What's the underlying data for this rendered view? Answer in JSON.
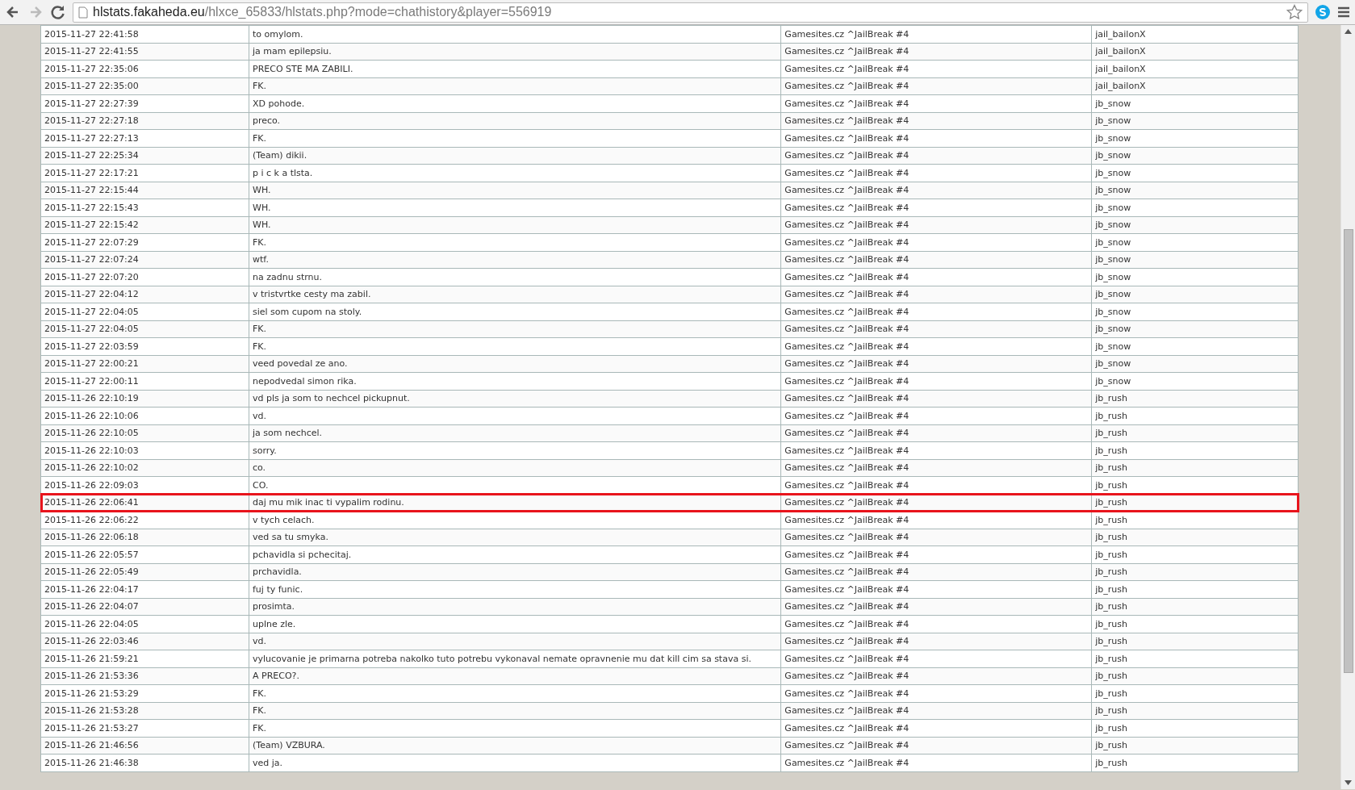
{
  "browser": {
    "url": {
      "host": "hlstats.fakaheda.eu",
      "path": "/hlxce_65833/hlstats.php?mode=chathistory&player=556919"
    }
  },
  "table": {
    "rows": [
      {
        "time": "2015-11-27 22:41:58",
        "message": "to omylom.",
        "server": "Gamesites.cz ^JailBreak #4",
        "map": "jail_bailonX",
        "selected": false
      },
      {
        "time": "2015-11-27 22:41:55",
        "message": "ja mam epilepsiu.",
        "server": "Gamesites.cz ^JailBreak #4",
        "map": "jail_bailonX",
        "selected": false
      },
      {
        "time": "2015-11-27 22:35:06",
        "message": "PRECO STE MA ZABILI.",
        "server": "Gamesites.cz ^JailBreak #4",
        "map": "jail_bailonX",
        "selected": false
      },
      {
        "time": "2015-11-27 22:35:00",
        "message": "FK.",
        "server": "Gamesites.cz ^JailBreak #4",
        "map": "jail_bailonX",
        "selected": false
      },
      {
        "time": "2015-11-27 22:27:39",
        "message": "XD pohode.",
        "server": "Gamesites.cz ^JailBreak #4",
        "map": "jb_snow",
        "selected": false
      },
      {
        "time": "2015-11-27 22:27:18",
        "message": "preco.",
        "server": "Gamesites.cz ^JailBreak #4",
        "map": "jb_snow",
        "selected": false
      },
      {
        "time": "2015-11-27 22:27:13",
        "message": "FK.",
        "server": "Gamesites.cz ^JailBreak #4",
        "map": "jb_snow",
        "selected": false
      },
      {
        "time": "2015-11-27 22:25:34",
        "message": "(Team) dikii.",
        "server": "Gamesites.cz ^JailBreak #4",
        "map": "jb_snow",
        "selected": false
      },
      {
        "time": "2015-11-27 22:17:21",
        "message": "p i c k a tlsta.",
        "server": "Gamesites.cz ^JailBreak #4",
        "map": "jb_snow",
        "selected": false
      },
      {
        "time": "2015-11-27 22:15:44",
        "message": "WH.",
        "server": "Gamesites.cz ^JailBreak #4",
        "map": "jb_snow",
        "selected": false
      },
      {
        "time": "2015-11-27 22:15:43",
        "message": "WH.",
        "server": "Gamesites.cz ^JailBreak #4",
        "map": "jb_snow",
        "selected": false
      },
      {
        "time": "2015-11-27 22:15:42",
        "message": "WH.",
        "server": "Gamesites.cz ^JailBreak #4",
        "map": "jb_snow",
        "selected": false
      },
      {
        "time": "2015-11-27 22:07:29",
        "message": "FK.",
        "server": "Gamesites.cz ^JailBreak #4",
        "map": "jb_snow",
        "selected": false
      },
      {
        "time": "2015-11-27 22:07:24",
        "message": "wtf.",
        "server": "Gamesites.cz ^JailBreak #4",
        "map": "jb_snow",
        "selected": false
      },
      {
        "time": "2015-11-27 22:07:20",
        "message": "na zadnu strnu.",
        "server": "Gamesites.cz ^JailBreak #4",
        "map": "jb_snow",
        "selected": false
      },
      {
        "time": "2015-11-27 22:04:12",
        "message": "v tristvrtke cesty ma zabil.",
        "server": "Gamesites.cz ^JailBreak #4",
        "map": "jb_snow",
        "selected": false
      },
      {
        "time": "2015-11-27 22:04:05",
        "message": "siel som cupom na stoly.",
        "server": "Gamesites.cz ^JailBreak #4",
        "map": "jb_snow",
        "selected": false
      },
      {
        "time": "2015-11-27 22:04:05",
        "message": "FK.",
        "server": "Gamesites.cz ^JailBreak #4",
        "map": "jb_snow",
        "selected": false
      },
      {
        "time": "2015-11-27 22:03:59",
        "message": "FK.",
        "server": "Gamesites.cz ^JailBreak #4",
        "map": "jb_snow",
        "selected": false
      },
      {
        "time": "2015-11-27 22:00:21",
        "message": "veed povedal ze ano.",
        "server": "Gamesites.cz ^JailBreak #4",
        "map": "jb_snow",
        "selected": false
      },
      {
        "time": "2015-11-27 22:00:11",
        "message": "nepodvedal simon rika.",
        "server": "Gamesites.cz ^JailBreak #4",
        "map": "jb_snow",
        "selected": false
      },
      {
        "time": "2015-11-26 22:10:19",
        "message": "vd pls ja som to nechcel pickupnut.",
        "server": "Gamesites.cz ^JailBreak #4",
        "map": "jb_rush",
        "selected": false
      },
      {
        "time": "2015-11-26 22:10:06",
        "message": "vd.",
        "server": "Gamesites.cz ^JailBreak #4",
        "map": "jb_rush",
        "selected": false
      },
      {
        "time": "2015-11-26 22:10:05",
        "message": "ja som nechcel.",
        "server": "Gamesites.cz ^JailBreak #4",
        "map": "jb_rush",
        "selected": false
      },
      {
        "time": "2015-11-26 22:10:03",
        "message": "sorry.",
        "server": "Gamesites.cz ^JailBreak #4",
        "map": "jb_rush",
        "selected": false
      },
      {
        "time": "2015-11-26 22:10:02",
        "message": "co.",
        "server": "Gamesites.cz ^JailBreak #4",
        "map": "jb_rush",
        "selected": false
      },
      {
        "time": "2015-11-26 22:09:03",
        "message": "CO.",
        "server": "Gamesites.cz ^JailBreak #4",
        "map": "jb_rush",
        "selected": false
      },
      {
        "time": "2015-11-26 22:06:41",
        "message": "daj mu mik inac ti vypalim rodinu.",
        "server": "Gamesites.cz ^JailBreak #4",
        "map": "jb_rush",
        "selected": true
      },
      {
        "time": "2015-11-26 22:06:22",
        "message": "v tych celach.",
        "server": "Gamesites.cz ^JailBreak #4",
        "map": "jb_rush",
        "selected": false
      },
      {
        "time": "2015-11-26 22:06:18",
        "message": "ved sa tu smyka.",
        "server": "Gamesites.cz ^JailBreak #4",
        "map": "jb_rush",
        "selected": false
      },
      {
        "time": "2015-11-26 22:05:57",
        "message": "pchavidla si pchecitaj.",
        "server": "Gamesites.cz ^JailBreak #4",
        "map": "jb_rush",
        "selected": false
      },
      {
        "time": "2015-11-26 22:05:49",
        "message": "prchavidla.",
        "server": "Gamesites.cz ^JailBreak #4",
        "map": "jb_rush",
        "selected": false
      },
      {
        "time": "2015-11-26 22:04:17",
        "message": "fuj ty funic.",
        "server": "Gamesites.cz ^JailBreak #4",
        "map": "jb_rush",
        "selected": false
      },
      {
        "time": "2015-11-26 22:04:07",
        "message": "prosimta.",
        "server": "Gamesites.cz ^JailBreak #4",
        "map": "jb_rush",
        "selected": false
      },
      {
        "time": "2015-11-26 22:04:05",
        "message": "uplne zle.",
        "server": "Gamesites.cz ^JailBreak #4",
        "map": "jb_rush",
        "selected": false
      },
      {
        "time": "2015-11-26 22:03:46",
        "message": "vd.",
        "server": "Gamesites.cz ^JailBreak #4",
        "map": "jb_rush",
        "selected": false
      },
      {
        "time": "2015-11-26 21:59:21",
        "message": "vylucovanie je primarna potreba nakolko tuto potrebu vykonaval nemate opravnenie mu dat kill cim sa stava si.",
        "server": "Gamesites.cz ^JailBreak #4",
        "map": "jb_rush",
        "selected": false
      },
      {
        "time": "2015-11-26 21:53:36",
        "message": "A PRECO?.",
        "server": "Gamesites.cz ^JailBreak #4",
        "map": "jb_rush",
        "selected": false
      },
      {
        "time": "2015-11-26 21:53:29",
        "message": "FK.",
        "server": "Gamesites.cz ^JailBreak #4",
        "map": "jb_rush",
        "selected": false
      },
      {
        "time": "2015-11-26 21:53:28",
        "message": "FK.",
        "server": "Gamesites.cz ^JailBreak #4",
        "map": "jb_rush",
        "selected": false
      },
      {
        "time": "2015-11-26 21:53:27",
        "message": "FK.",
        "server": "Gamesites.cz ^JailBreak #4",
        "map": "jb_rush",
        "selected": false
      },
      {
        "time": "2015-11-26 21:46:56",
        "message": "(Team) VZBURA.",
        "server": "Gamesites.cz ^JailBreak #4",
        "map": "jb_rush",
        "selected": false
      },
      {
        "time": "2015-11-26 21:46:38",
        "message": "ved ja.",
        "server": "Gamesites.cz ^JailBreak #4",
        "map": "jb_rush",
        "selected": false
      }
    ]
  }
}
